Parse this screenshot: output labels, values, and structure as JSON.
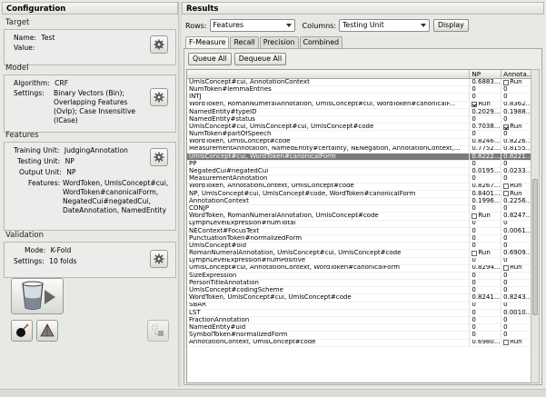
{
  "left": {
    "title": "Configuration",
    "target": {
      "label": "Target",
      "name_key": "Name:",
      "name_val": "Test",
      "value_key": "Value:",
      "value_val": ""
    },
    "model": {
      "label": "Model",
      "alg_key": "Algorithm:",
      "alg_val": "CRF",
      "set_key": "Settings:",
      "set_lines": [
        "Binary Vectors (Bin);",
        "Overlapping Features",
        "(Ovlp); Case Insensitive",
        "(ICase)"
      ]
    },
    "features": {
      "label": "Features",
      "train_key": "Training Unit:",
      "train_val": "JudgingAnnotation",
      "test_key": "Testing Unit:",
      "test_val": "NP",
      "out_key": "Output Unit:",
      "out_val": "NP",
      "feat_key": "Features:",
      "feat_lines": [
        "WordToken, UmlsConcept#cui,",
        "WordToken#canonicalForm,",
        "NegatedCui#negatedCui,",
        "DateAnnotation, NamedEntity"
      ]
    },
    "validation": {
      "label": "Validation",
      "mode_key": "Mode:",
      "mode_val": "K-Fold",
      "set_key": "Settings:",
      "set_val": "10 folds"
    }
  },
  "right": {
    "title": "Results",
    "rows_label": "Rows:",
    "rows_value": "Features",
    "cols_label": "Columns:",
    "cols_value": "Testing Unit",
    "display_label": "Display",
    "tabs": [
      "F-Measure",
      "Recall",
      "Precision",
      "Combined"
    ],
    "queue_all": "Queue All",
    "dequeue_all": "Dequeue All",
    "headers": [
      "",
      "NP",
      "Annota..."
    ],
    "rows": [
      {
        "name": "UmlsConcept#cui, AnnotationContext",
        "np": "0.6883...",
        "ann": "Run",
        "ann_chk": false
      },
      {
        "name": "NumToken#lemmaEntries",
        "np": "0",
        "ann": "0"
      },
      {
        "name": "INTJ",
        "np": "0",
        "ann": "0"
      },
      {
        "name": "WordToken, RomanNumeralAnnotation, UmlsConcept#cui, WordToken#canonicalF...",
        "np": "Run",
        "np_chk": true,
        "ann": "0.8362..."
      },
      {
        "name": "NamedEntity#typeID",
        "np": "0.2029...",
        "ann": "0.1988..."
      },
      {
        "name": "NamedEntity#status",
        "np": "0",
        "ann": "0"
      },
      {
        "name": "UmlsConcept#cui, UmlsConcept#cui, UmlsConcept#code",
        "np": "0.7038...",
        "ann": "Run",
        "ann_chk": true
      },
      {
        "name": "NumToken#partOfSpeech",
        "np": "0",
        "ann": "0"
      },
      {
        "name": "WordToken, UmlsConcept#code",
        "np": "0.8246...",
        "ann": "0.8226..."
      },
      {
        "name": "MeasurementAnnotation, NamedEntity#certainty, NENegation, AnnotationContext,...",
        "np": "0.7752...",
        "ann": "0.8155..."
      },
      {
        "name": "UmlsConcept#cui, WordToken#canonicalForm",
        "np": "0.8222...",
        "ann": "0.8221...",
        "selected": true
      },
      {
        "name": "PP",
        "np": "0",
        "ann": "0"
      },
      {
        "name": "NegatedCui#negatedCui",
        "np": "0.0195...",
        "ann": "0.0233..."
      },
      {
        "name": "MeasurementAnnotation",
        "np": "0",
        "ann": "0"
      },
      {
        "name": "WordToken, AnnotationContext, UmlsConcept#code",
        "np": "0.8267...",
        "ann": "Run",
        "ann_chk": false
      },
      {
        "name": "NP, UmlsConcept#cui, UmlsConcept#code, WordToken#canonicalForm",
        "np": "0.8401...",
        "ann": "Run",
        "ann_chk": false
      },
      {
        "name": "AnnotationContext",
        "np": "0.1996...",
        "ann": "0.2256..."
      },
      {
        "name": "CONJP",
        "np": "0",
        "ann": "0"
      },
      {
        "name": "WordToken, RomanNumeralAnnotation, UmlsConcept#code",
        "np": "Run",
        "np_chk": false,
        "ann": "0.8247..."
      },
      {
        "name": "LymphLevelExpression#numTotal",
        "np": "0",
        "ann": "0"
      },
      {
        "name": "NEContext#FocusText",
        "np": "0",
        "ann": "0.0061..."
      },
      {
        "name": "PunctuationToken#normalizedForm",
        "np": "0",
        "ann": "0"
      },
      {
        "name": "UmlsConcept#oid",
        "np": "0",
        "ann": "0"
      },
      {
        "name": "RomanNumeralAnnotation, UmlsConcept#cui, UmlsConcept#code",
        "np": "Run",
        "np_chk": false,
        "ann": "0.6909..."
      },
      {
        "name": "LymphLevelExpression#numPositive",
        "np": "0",
        "ann": "0"
      },
      {
        "name": "UmlsConcept#cui, AnnotationContext, WordToken#canonicalForm",
        "np": "0.8294...",
        "ann": "Run",
        "ann_chk": false
      },
      {
        "name": "SizeExpression",
        "np": "0",
        "ann": "0"
      },
      {
        "name": "PersonTitleAnnotation",
        "np": "0",
        "ann": "0"
      },
      {
        "name": "UmlsConcept#codingScheme",
        "np": "0",
        "ann": "0"
      },
      {
        "name": "WordToken, UmlsConcept#cui, UmlsConcept#code",
        "np": "0.8241...",
        "ann": "0.8243..."
      },
      {
        "name": "SBAR",
        "np": "0",
        "ann": "0"
      },
      {
        "name": "LST",
        "np": "0",
        "ann": "0.0010..."
      },
      {
        "name": "FractionAnnotation",
        "np": "0",
        "ann": "0"
      },
      {
        "name": "NamedEntity#uid",
        "np": "0",
        "ann": "0"
      },
      {
        "name": "SymbolToken#normalizedForm",
        "np": "0",
        "ann": "0"
      },
      {
        "name": "AnnotationContext, UmlsConcept#code",
        "np": "0.6980...",
        "ann": "Run",
        "ann_chk": false
      }
    ]
  }
}
